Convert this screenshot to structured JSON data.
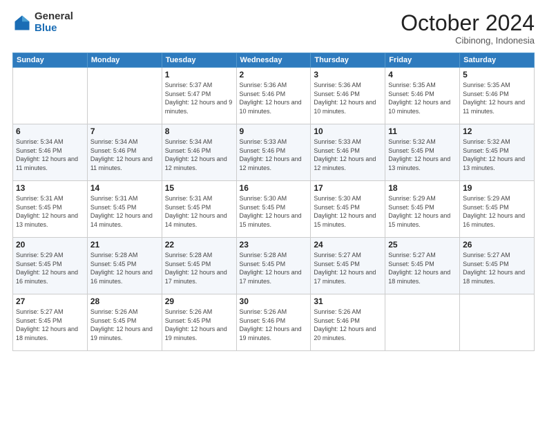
{
  "header": {
    "logo_general": "General",
    "logo_blue": "Blue",
    "month_title": "October 2024",
    "location": "Cibinong, Indonesia"
  },
  "days_of_week": [
    "Sunday",
    "Monday",
    "Tuesday",
    "Wednesday",
    "Thursday",
    "Friday",
    "Saturday"
  ],
  "weeks": [
    [
      {
        "day": "",
        "sunrise": "",
        "sunset": "",
        "daylight": ""
      },
      {
        "day": "",
        "sunrise": "",
        "sunset": "",
        "daylight": ""
      },
      {
        "day": "1",
        "sunrise": "Sunrise: 5:37 AM",
        "sunset": "Sunset: 5:47 PM",
        "daylight": "Daylight: 12 hours and 9 minutes."
      },
      {
        "day": "2",
        "sunrise": "Sunrise: 5:36 AM",
        "sunset": "Sunset: 5:46 PM",
        "daylight": "Daylight: 12 hours and 10 minutes."
      },
      {
        "day": "3",
        "sunrise": "Sunrise: 5:36 AM",
        "sunset": "Sunset: 5:46 PM",
        "daylight": "Daylight: 12 hours and 10 minutes."
      },
      {
        "day": "4",
        "sunrise": "Sunrise: 5:35 AM",
        "sunset": "Sunset: 5:46 PM",
        "daylight": "Daylight: 12 hours and 10 minutes."
      },
      {
        "day": "5",
        "sunrise": "Sunrise: 5:35 AM",
        "sunset": "Sunset: 5:46 PM",
        "daylight": "Daylight: 12 hours and 11 minutes."
      }
    ],
    [
      {
        "day": "6",
        "sunrise": "Sunrise: 5:34 AM",
        "sunset": "Sunset: 5:46 PM",
        "daylight": "Daylight: 12 hours and 11 minutes."
      },
      {
        "day": "7",
        "sunrise": "Sunrise: 5:34 AM",
        "sunset": "Sunset: 5:46 PM",
        "daylight": "Daylight: 12 hours and 11 minutes."
      },
      {
        "day": "8",
        "sunrise": "Sunrise: 5:34 AM",
        "sunset": "Sunset: 5:46 PM",
        "daylight": "Daylight: 12 hours and 12 minutes."
      },
      {
        "day": "9",
        "sunrise": "Sunrise: 5:33 AM",
        "sunset": "Sunset: 5:46 PM",
        "daylight": "Daylight: 12 hours and 12 minutes."
      },
      {
        "day": "10",
        "sunrise": "Sunrise: 5:33 AM",
        "sunset": "Sunset: 5:46 PM",
        "daylight": "Daylight: 12 hours and 12 minutes."
      },
      {
        "day": "11",
        "sunrise": "Sunrise: 5:32 AM",
        "sunset": "Sunset: 5:45 PM",
        "daylight": "Daylight: 12 hours and 13 minutes."
      },
      {
        "day": "12",
        "sunrise": "Sunrise: 5:32 AM",
        "sunset": "Sunset: 5:45 PM",
        "daylight": "Daylight: 12 hours and 13 minutes."
      }
    ],
    [
      {
        "day": "13",
        "sunrise": "Sunrise: 5:31 AM",
        "sunset": "Sunset: 5:45 PM",
        "daylight": "Daylight: 12 hours and 13 minutes."
      },
      {
        "day": "14",
        "sunrise": "Sunrise: 5:31 AM",
        "sunset": "Sunset: 5:45 PM",
        "daylight": "Daylight: 12 hours and 14 minutes."
      },
      {
        "day": "15",
        "sunrise": "Sunrise: 5:31 AM",
        "sunset": "Sunset: 5:45 PM",
        "daylight": "Daylight: 12 hours and 14 minutes."
      },
      {
        "day": "16",
        "sunrise": "Sunrise: 5:30 AM",
        "sunset": "Sunset: 5:45 PM",
        "daylight": "Daylight: 12 hours and 15 minutes."
      },
      {
        "day": "17",
        "sunrise": "Sunrise: 5:30 AM",
        "sunset": "Sunset: 5:45 PM",
        "daylight": "Daylight: 12 hours and 15 minutes."
      },
      {
        "day": "18",
        "sunrise": "Sunrise: 5:29 AM",
        "sunset": "Sunset: 5:45 PM",
        "daylight": "Daylight: 12 hours and 15 minutes."
      },
      {
        "day": "19",
        "sunrise": "Sunrise: 5:29 AM",
        "sunset": "Sunset: 5:45 PM",
        "daylight": "Daylight: 12 hours and 16 minutes."
      }
    ],
    [
      {
        "day": "20",
        "sunrise": "Sunrise: 5:29 AM",
        "sunset": "Sunset: 5:45 PM",
        "daylight": "Daylight: 12 hours and 16 minutes."
      },
      {
        "day": "21",
        "sunrise": "Sunrise: 5:28 AM",
        "sunset": "Sunset: 5:45 PM",
        "daylight": "Daylight: 12 hours and 16 minutes."
      },
      {
        "day": "22",
        "sunrise": "Sunrise: 5:28 AM",
        "sunset": "Sunset: 5:45 PM",
        "daylight": "Daylight: 12 hours and 17 minutes."
      },
      {
        "day": "23",
        "sunrise": "Sunrise: 5:28 AM",
        "sunset": "Sunset: 5:45 PM",
        "daylight": "Daylight: 12 hours and 17 minutes."
      },
      {
        "day": "24",
        "sunrise": "Sunrise: 5:27 AM",
        "sunset": "Sunset: 5:45 PM",
        "daylight": "Daylight: 12 hours and 17 minutes."
      },
      {
        "day": "25",
        "sunrise": "Sunrise: 5:27 AM",
        "sunset": "Sunset: 5:45 PM",
        "daylight": "Daylight: 12 hours and 18 minutes."
      },
      {
        "day": "26",
        "sunrise": "Sunrise: 5:27 AM",
        "sunset": "Sunset: 5:45 PM",
        "daylight": "Daylight: 12 hours and 18 minutes."
      }
    ],
    [
      {
        "day": "27",
        "sunrise": "Sunrise: 5:27 AM",
        "sunset": "Sunset: 5:45 PM",
        "daylight": "Daylight: 12 hours and 18 minutes."
      },
      {
        "day": "28",
        "sunrise": "Sunrise: 5:26 AM",
        "sunset": "Sunset: 5:45 PM",
        "daylight": "Daylight: 12 hours and 19 minutes."
      },
      {
        "day": "29",
        "sunrise": "Sunrise: 5:26 AM",
        "sunset": "Sunset: 5:45 PM",
        "daylight": "Daylight: 12 hours and 19 minutes."
      },
      {
        "day": "30",
        "sunrise": "Sunrise: 5:26 AM",
        "sunset": "Sunset: 5:46 PM",
        "daylight": "Daylight: 12 hours and 19 minutes."
      },
      {
        "day": "31",
        "sunrise": "Sunrise: 5:26 AM",
        "sunset": "Sunset: 5:46 PM",
        "daylight": "Daylight: 12 hours and 20 minutes."
      },
      {
        "day": "",
        "sunrise": "",
        "sunset": "",
        "daylight": ""
      },
      {
        "day": "",
        "sunrise": "",
        "sunset": "",
        "daylight": ""
      }
    ]
  ]
}
